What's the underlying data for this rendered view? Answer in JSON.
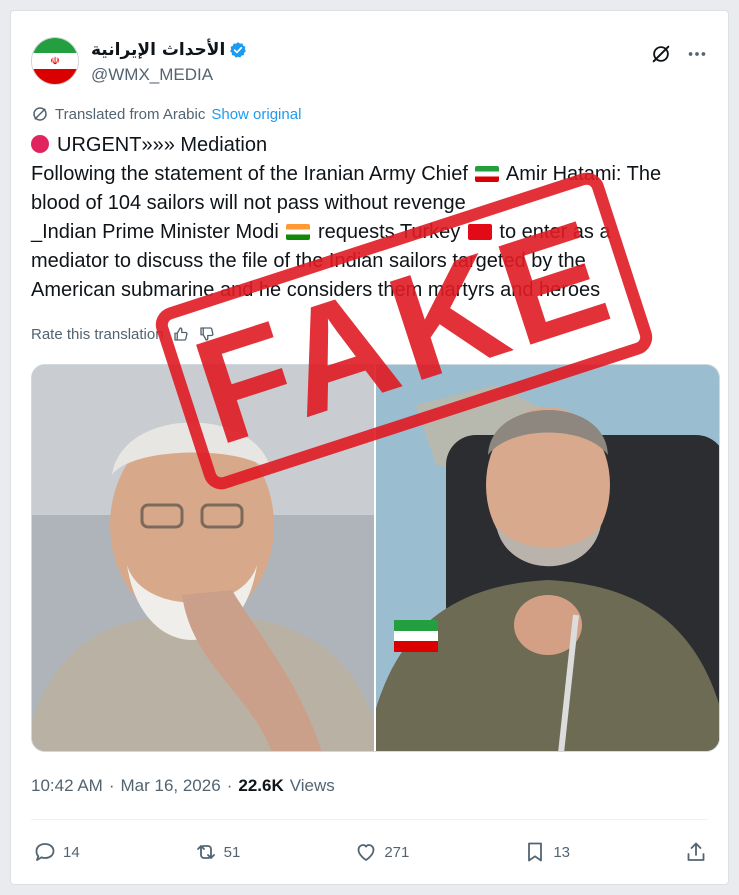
{
  "account": {
    "display_name": "الأحداث الإيرانية",
    "handle": "@WMX_MEDIA",
    "avatar_emblem": "☫"
  },
  "translation": {
    "label": "Translated from Arabic",
    "show_original": "Show original",
    "rate": "Rate this translation"
  },
  "tweet": {
    "line1": "URGENT»»» Mediation",
    "line2_a": "Following the statement of the Iranian Army Chief",
    "line2_b": "Amir Hatami: The",
    "line3": "blood of 104 sailors will not pass without revenge",
    "line4_a": "_Indian Prime Minister Modi",
    "line4_b": "requests Turkey",
    "line4_c": "to enter as a",
    "line5": "mediator to discuss the file of the Indian sailors targeted by the",
    "line6": "American submarine and he considers them martyrs and heroes"
  },
  "stamp": {
    "text": "FAKE"
  },
  "meta": {
    "time": "10:42 AM",
    "date": "Mar 16, 2026",
    "views_count": "22.6K",
    "views_label": "Views"
  },
  "actions": {
    "replies": "14",
    "reposts": "51",
    "likes": "271",
    "bookmarks": "13"
  },
  "colors": {
    "link": "#1d9bf0",
    "stamp": "#e01b24",
    "muted": "#536471"
  }
}
